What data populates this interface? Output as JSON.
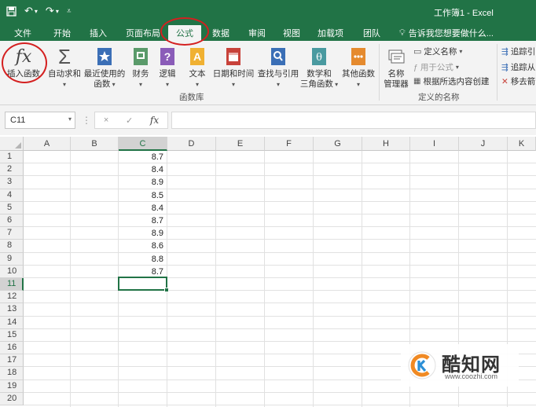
{
  "window": {
    "title": "工作簿1 - Excel"
  },
  "tabs": [
    {
      "label": "文件"
    },
    {
      "label": "开始"
    },
    {
      "label": "插入"
    },
    {
      "label": "页面布局"
    },
    {
      "label": "公式"
    },
    {
      "label": "数据"
    },
    {
      "label": "审阅"
    },
    {
      "label": "视图"
    },
    {
      "label": "加载项"
    },
    {
      "label": "团队"
    }
  ],
  "active_tab": "公式",
  "tell_me": "告诉我您想要做什么...",
  "ribbon": {
    "insert_function": {
      "icon_text": "fx",
      "label": "插入函数"
    },
    "autosum": {
      "label": "自动求和"
    },
    "recent": {
      "line1": "最近使用的",
      "line2": "函数"
    },
    "financial": {
      "label": "财务"
    },
    "logical": {
      "label": "逻辑"
    },
    "text": {
      "label": "文本"
    },
    "datetime": {
      "label": "日期和时间"
    },
    "lookup": {
      "label": "查找与引用"
    },
    "math": {
      "line1": "数学和",
      "line2": "三角函数"
    },
    "more": {
      "label": "其他函数"
    },
    "library_group": "函数库",
    "name_manager": {
      "line1": "名称",
      "line2": "管理器"
    },
    "define_name": "定义名称",
    "use_in_formula": "用于公式",
    "create_from_selection": "根据所选内容创建",
    "names_group": "定义的名称",
    "trace_precedents": "追踪引",
    "trace_dependents": "追踪从",
    "remove_arrows": "移去箭"
  },
  "formula_bar": {
    "name_box": "C11",
    "cancel": "×",
    "enter": "✓",
    "fx": "fx",
    "value": ""
  },
  "columns": [
    "A",
    "B",
    "C",
    "D",
    "E",
    "F",
    "G",
    "H",
    "I",
    "J",
    "K"
  ],
  "rows": [
    "1",
    "2",
    "3",
    "4",
    "5",
    "6",
    "7",
    "8",
    "9",
    "10",
    "11",
    "12",
    "13",
    "14",
    "15",
    "16",
    "17",
    "18",
    "19",
    "20"
  ],
  "cells_c": [
    "8.7",
    "8.4",
    "8.9",
    "8.5",
    "8.4",
    "8.7",
    "8.9",
    "8.6",
    "8.8",
    "8.7"
  ],
  "watermark": {
    "name": "酷知网",
    "url": "www.coozhi.com"
  },
  "colors": {
    "excel_green": "#217346",
    "annotation_red": "#d42020"
  }
}
